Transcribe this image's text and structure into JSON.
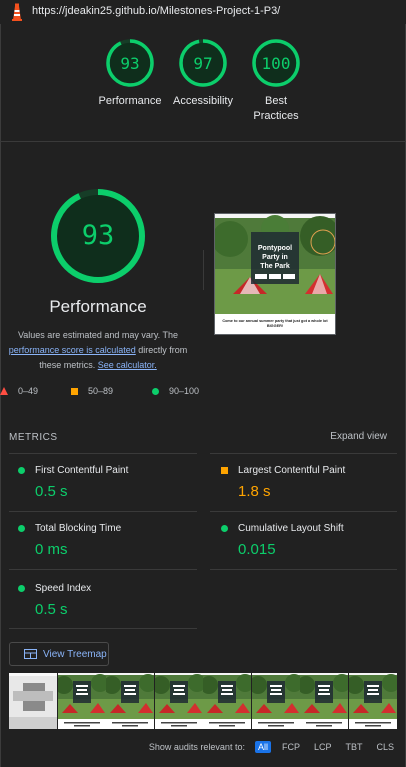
{
  "browser": {
    "url": "https://jdeakin25.github.io/Milestones-Project-1-P3/"
  },
  "summary": [
    {
      "score": "93",
      "label": "Performance",
      "value": 0.93
    },
    {
      "score": "97",
      "label": "Accessibility",
      "value": 0.97
    },
    {
      "score": "100",
      "label": "Best Practices",
      "value": 1.0
    }
  ],
  "performance": {
    "score": "93",
    "value": 0.93,
    "title": "Performance",
    "desc_prefix": "Values are estimated and may vary. The",
    "score_link": "performance score is calculated",
    "desc_mid": "directly from these metrics.",
    "calc_link": "See calculator."
  },
  "screenshot": {
    "hero_title": "Pontypool Party in The Park",
    "tagline": "Come to our annual summer party that just got a whole lot BIGGER!"
  },
  "legend": [
    {
      "range": "0–49",
      "color": "#ff4e42"
    },
    {
      "range": "50–89",
      "color": "#ffa400"
    },
    {
      "range": "90–100",
      "color": "#0cce6b"
    }
  ],
  "metrics": {
    "heading": "METRICS",
    "expand": "Expand view",
    "items": [
      {
        "name": "First Contentful Paint",
        "value": "0.5 s",
        "status": "pass"
      },
      {
        "name": "Largest Contentful Paint",
        "value": "1.8 s",
        "status": "average"
      },
      {
        "name": "Total Blocking Time",
        "value": "0 ms",
        "status": "pass"
      },
      {
        "name": "Cumulative Layout Shift",
        "value": "0.015",
        "status": "pass"
      },
      {
        "name": "Speed Index",
        "value": "0.5 s",
        "status": "pass"
      }
    ]
  },
  "treemap": {
    "label": "View Treemap"
  },
  "filters": {
    "label": "Show audits relevant to:",
    "options": [
      "All",
      "FCP",
      "LCP",
      "TBT",
      "CLS"
    ],
    "active": "All"
  },
  "colors": {
    "pass": "#0cce6b",
    "average": "#ffa400",
    "fail": "#ff4e42",
    "link": "#8ab4f8"
  }
}
